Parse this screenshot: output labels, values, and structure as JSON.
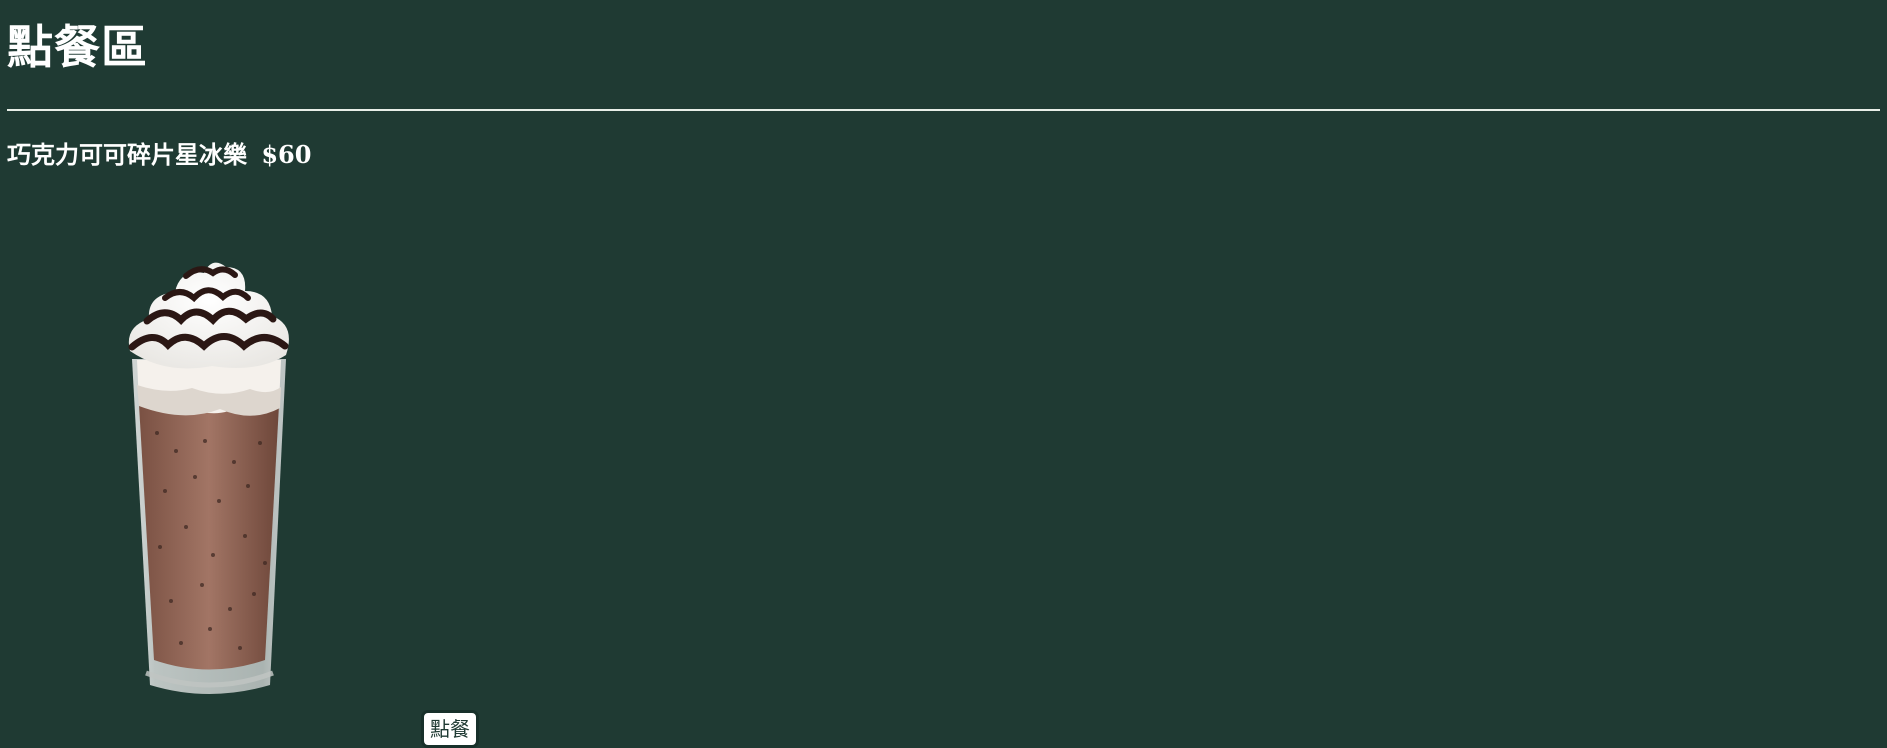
{
  "page": {
    "title": "點餐區"
  },
  "menu": {
    "items": [
      {
        "name": "巧克力可可碎片星冰樂",
        "price": "$60",
        "image_icon": "chocolate-frappuccino-image",
        "order_label": "點餐"
      }
    ]
  },
  "colors": {
    "background": "#1f3a33",
    "text": "#ffffff",
    "divider": "#e8eee8",
    "button_background": "#ffffff",
    "button_text": "#1f3a33"
  }
}
